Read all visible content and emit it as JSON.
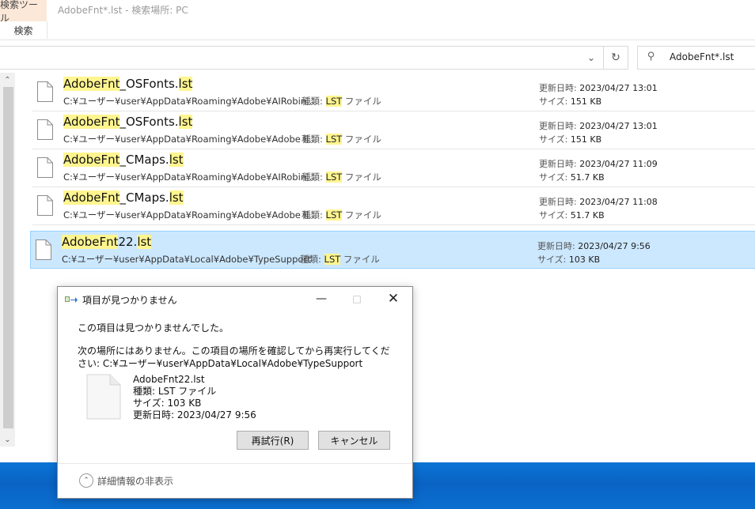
{
  "ribbon": {
    "context_tab": "検索ツール",
    "title": "AdobeFnt*.lst - 検索場所: PC",
    "tab_search": "検索"
  },
  "search": {
    "query": "AdobeFnt*.lst"
  },
  "results": [
    {
      "name_pre": "",
      "name_hl1": "AdobeFnt",
      "name_mid": "_OSFonts.",
      "name_hl2": "lst",
      "path": "C:¥ユーザー¥user¥AppData¥Roaming¥Adobe¥AIRobin ...",
      "type_label": "種類: ",
      "type_hl": "LST",
      "type_rest": " ファイル",
      "date_label": "更新日時: ",
      "date": "2023/04/27 13:01",
      "size_label": "サイズ: ",
      "size": "151 KB"
    },
    {
      "name_pre": "",
      "name_hl1": "AdobeFnt",
      "name_mid": "_OSFonts.",
      "name_hl2": "lst",
      "path": "C:¥ユーザー¥user¥AppData¥Roaming¥Adobe¥Adobe Il...",
      "type_label": "種類: ",
      "type_hl": "LST",
      "type_rest": " ファイル",
      "date_label": "更新日時: ",
      "date": "2023/04/27 13:01",
      "size_label": "サイズ: ",
      "size": "151 KB"
    },
    {
      "name_pre": "",
      "name_hl1": "AdobeFnt",
      "name_mid": "_CMaps.",
      "name_hl2": "lst",
      "path": "C:¥ユーザー¥user¥AppData¥Roaming¥Adobe¥AIRobin ...",
      "type_label": "種類: ",
      "type_hl": "LST",
      "type_rest": " ファイル",
      "date_label": "更新日時: ",
      "date": "2023/04/27 11:09",
      "size_label": "サイズ: ",
      "size": "51.7 KB"
    },
    {
      "name_pre": "",
      "name_hl1": "AdobeFnt",
      "name_mid": "_CMaps.",
      "name_hl2": "lst",
      "path": "C:¥ユーザー¥user¥AppData¥Roaming¥Adobe¥Adobe Il...",
      "type_label": "種類: ",
      "type_hl": "LST",
      "type_rest": " ファイル",
      "date_label": "更新日時: ",
      "date": "2023/04/27 11:08",
      "size_label": "サイズ: ",
      "size": "51.7 KB"
    },
    {
      "name_pre": "",
      "name_hl1": "AdobeFnt",
      "name_mid": "22.",
      "name_hl2": "lst",
      "path": "C:¥ユーザー¥user¥AppData¥Local¥Adobe¥TypeSupport",
      "type_label": "種類: ",
      "type_hl": "LST",
      "type_rest": " ファイル",
      "date_label": "更新日時: ",
      "date": "2023/04/27 9:56",
      "size_label": "サイズ: ",
      "size": "103 KB",
      "selected": true
    }
  ],
  "dialog": {
    "title": "項目が見つかりません",
    "message": "この項目は見つかりませんでした。",
    "detail": "次の場所にはありません。この項目の場所を確認してから再実行してください: C:¥ユーザー¥user¥AppData¥Local¥Adobe¥TypeSupport",
    "file_name": "AdobeFnt22.lst",
    "file_type": "種類: LST ファイル",
    "file_size": "サイズ: 103 KB",
    "file_date": "更新日時: 2023/04/27 9:56",
    "retry_label": "再試行(R)",
    "cancel_label": "キャンセル",
    "footer_label": "詳細情報の非表示"
  },
  "colors": {
    "highlight": "#fff58f",
    "selection_bg": "#cce8ff",
    "selection_border": "#99d1ff",
    "context_tab_bg": "#fce8d9",
    "desktop_blue": "#0a6cd0"
  }
}
